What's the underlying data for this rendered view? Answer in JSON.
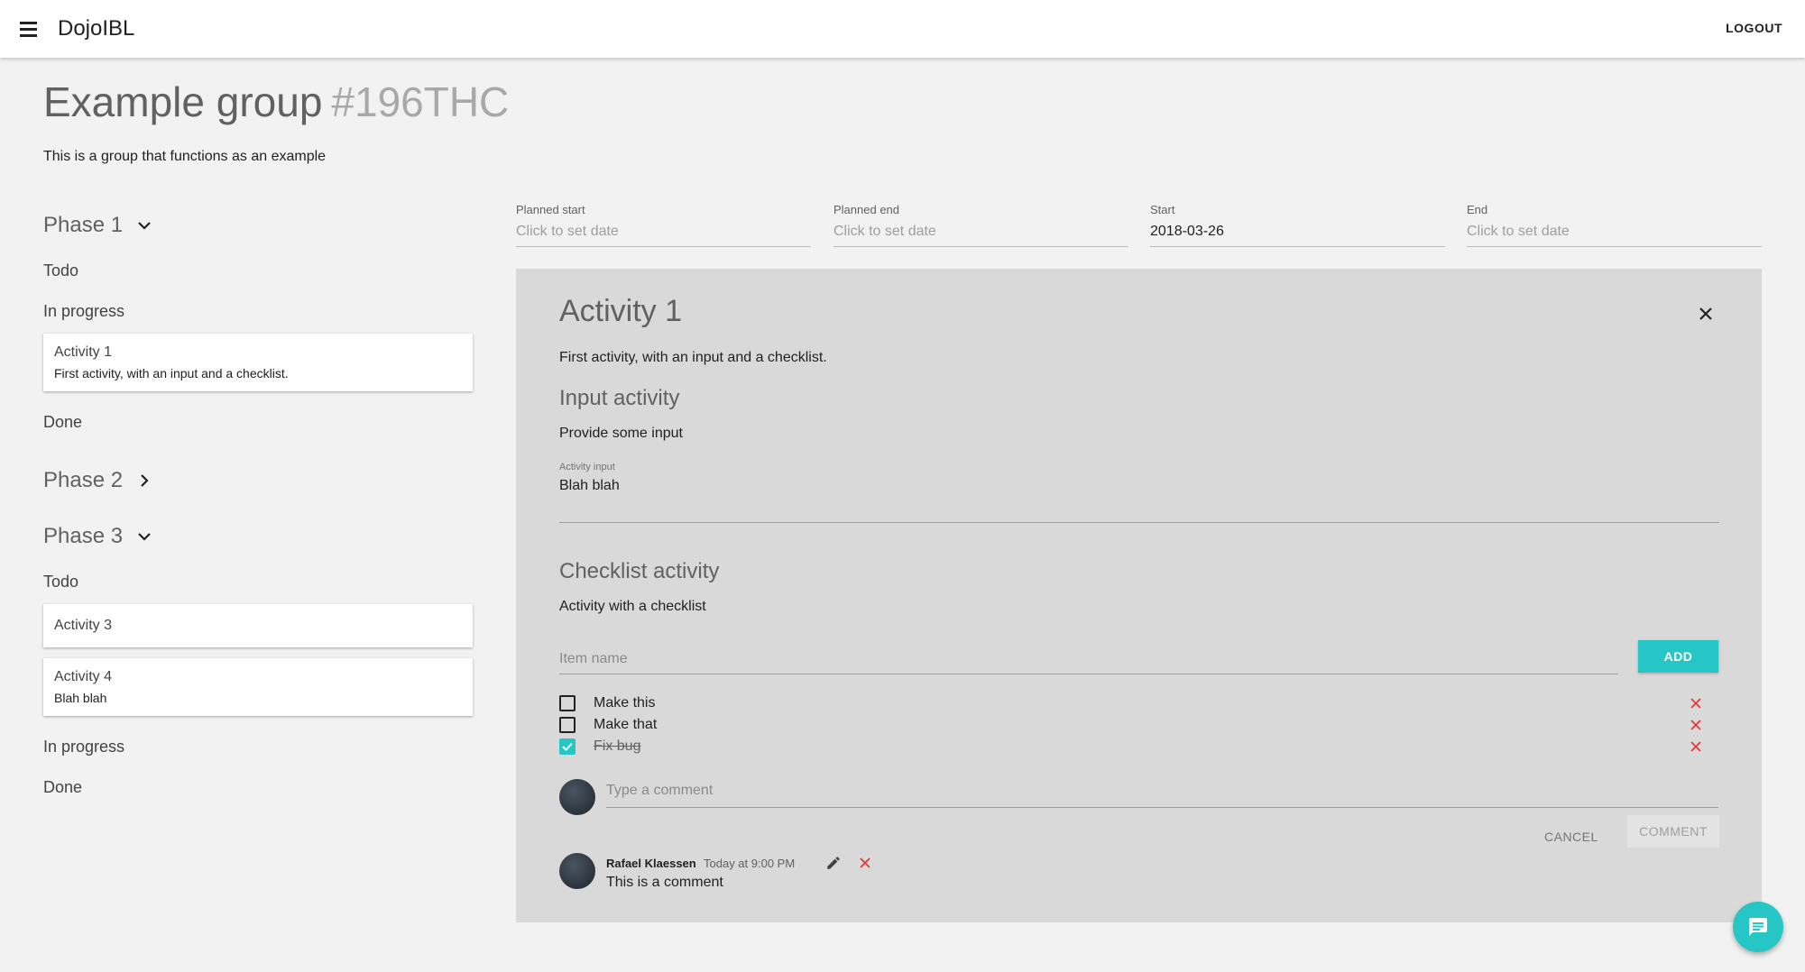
{
  "app": {
    "title": "DojoIBL",
    "logout_label": "LOGOUT"
  },
  "group": {
    "title": "Example group",
    "code": "#196THC",
    "description": "This is a group that functions as an example"
  },
  "phases": [
    {
      "name": "Phase 1",
      "expanded": true
    },
    {
      "name": "Phase 2",
      "expanded": false
    },
    {
      "name": "Phase 3",
      "expanded": true
    }
  ],
  "labels": {
    "todo": "Todo",
    "in_progress": "In progress",
    "done": "Done"
  },
  "cards": {
    "activity1": {
      "title": "Activity 1",
      "desc": "First activity, with an input and a checklist."
    },
    "activity3": {
      "title": "Activity 3"
    },
    "activity4": {
      "title": "Activity 4",
      "desc": "Blah blah"
    }
  },
  "dates": {
    "planned_start": {
      "label": "Planned start",
      "value": "Click to set date"
    },
    "planned_end": {
      "label": "Planned end",
      "value": "Click to set date"
    },
    "start": {
      "label": "Start",
      "value": "2018-03-26"
    },
    "end": {
      "label": "End",
      "value": "Click to set date"
    }
  },
  "activity": {
    "title": "Activity 1",
    "description": "First activity, with an input and a checklist.",
    "input_section": {
      "title": "Input activity",
      "description": "Provide some input",
      "field_label": "Activity input",
      "field_value": "Blah blah"
    },
    "checklist_section": {
      "title": "Checklist activity",
      "description": "Activity with a checklist",
      "item_placeholder": "Item name",
      "add_label": "ADD",
      "items": [
        {
          "text": "Make this",
          "checked": false
        },
        {
          "text": "Make that",
          "checked": false
        },
        {
          "text": "Fix bug",
          "checked": true
        }
      ]
    },
    "comments": {
      "placeholder": "Type a comment",
      "cancel_label": "CANCEL",
      "comment_label": "COMMENT",
      "list": [
        {
          "author": "Rafael Klaessen",
          "time": "Today at 9:00 PM",
          "text": "This is a comment"
        }
      ]
    }
  },
  "colors": {
    "accent": "#26c6c6",
    "delete": "#e53935",
    "panel": "#d9d9d9",
    "background": "#f2f2f2"
  },
  "icons": {
    "menu": "menu-icon",
    "close": "close-icon",
    "edit": "pencil-icon",
    "delete": "close-icon",
    "chat": "chat-icon"
  }
}
